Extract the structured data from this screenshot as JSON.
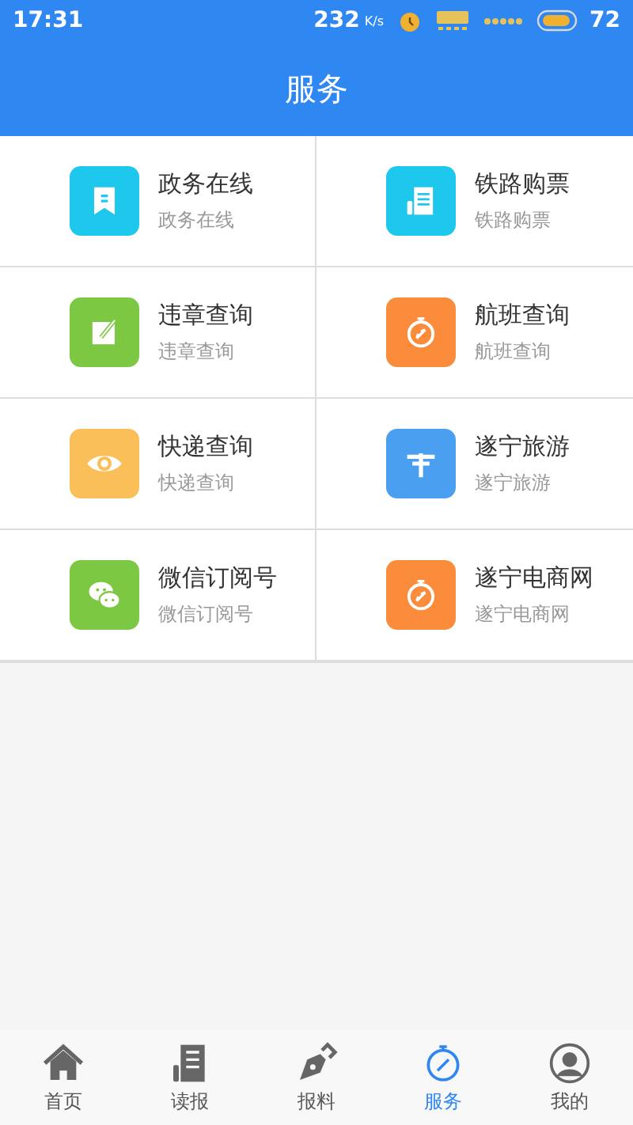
{
  "status_bar": {
    "time": "17:31",
    "speed": "232",
    "speed_unit": "K/s",
    "battery": "72"
  },
  "header": {
    "title": "服务"
  },
  "services": [
    {
      "title": "政务在线",
      "subtitle": "政务在线",
      "kind": "bookmark",
      "color": "#1ec8ec"
    },
    {
      "title": "铁路购票",
      "subtitle": "铁路购票",
      "kind": "newspaper",
      "color": "#1ec8ec"
    },
    {
      "title": "违章查询",
      "subtitle": "违章查询",
      "kind": "edit",
      "color": "#7dc843"
    },
    {
      "title": "航班查询",
      "subtitle": "航班查询",
      "kind": "compass",
      "color": "#fa8c3c"
    },
    {
      "title": "快递查询",
      "subtitle": "快递查询",
      "kind": "eye",
      "color": "#fbbf5a"
    },
    {
      "title": "遂宁旅游",
      "subtitle": "遂宁旅游",
      "kind": "signpost",
      "color": "#4a9ff0"
    },
    {
      "title": "微信订阅号",
      "subtitle": "微信订阅号",
      "kind": "chat",
      "color": "#7dc843"
    },
    {
      "title": "遂宁电商网",
      "subtitle": "遂宁电商网",
      "kind": "compass",
      "color": "#fa8c3c"
    }
  ],
  "tab_bar": [
    {
      "label": "首页",
      "kind": "home",
      "selected": false
    },
    {
      "label": "读报",
      "kind": "newspaper",
      "selected": false
    },
    {
      "label": "报料",
      "kind": "pen",
      "selected": false
    },
    {
      "label": "服务",
      "kind": "compass",
      "selected": true
    },
    {
      "label": "我的",
      "kind": "person",
      "selected": false
    }
  ]
}
